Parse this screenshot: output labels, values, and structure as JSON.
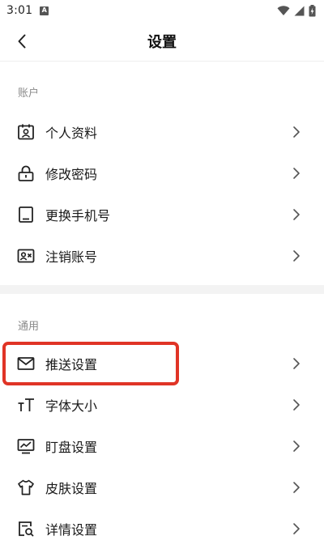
{
  "status_bar": {
    "time": "3:01",
    "notification_icon": "a-notification-icon",
    "wifi_icon": "wifi-icon",
    "signal_icon": "cellular-signal-icon",
    "battery_icon": "battery-charging-icon"
  },
  "header": {
    "title": "设置",
    "back_icon": "chevron-left-icon"
  },
  "sections": {
    "account": {
      "title": "账户",
      "items": [
        {
          "label": "个人资料",
          "icon": "profile-card-icon"
        },
        {
          "label": "修改密码",
          "icon": "lock-icon"
        },
        {
          "label": "更换手机号",
          "icon": "phone-icon"
        },
        {
          "label": "注销账号",
          "icon": "id-card-remove-icon"
        }
      ]
    },
    "general": {
      "title": "通用",
      "items": [
        {
          "label": "推送设置",
          "icon": "mail-icon"
        },
        {
          "label": "字体大小",
          "icon": "font-size-icon"
        },
        {
          "label": "盯盘设置",
          "icon": "chart-monitor-icon"
        },
        {
          "label": "皮肤设置",
          "icon": "shirt-icon"
        },
        {
          "label": "详情设置",
          "icon": "detail-search-icon"
        }
      ]
    }
  },
  "highlight": {
    "target": "推送设置",
    "color": "#e03426"
  },
  "colors": {
    "text": "#1a1a1a",
    "section_title": "#8a8a8a",
    "divider": "#f3f3f3",
    "chevron": "#555555"
  }
}
